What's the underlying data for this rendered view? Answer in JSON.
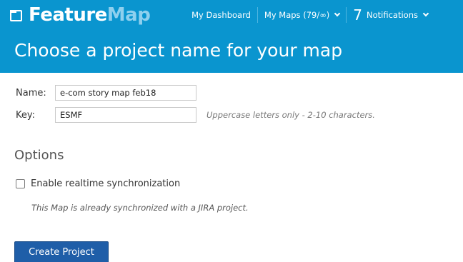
{
  "header": {
    "logo_part1": "Feature",
    "logo_part2": "Map",
    "nav": {
      "dashboard_label": "My Dashboard",
      "maps_label": "My Maps (79/∞)",
      "notifications_count": "7",
      "notifications_label": "Notifications"
    }
  },
  "page": {
    "title": "Choose a project name for your map"
  },
  "form": {
    "name": {
      "label": "Name:",
      "value": "e-com story map feb18"
    },
    "key": {
      "label": "Key:",
      "value": "ESMF",
      "hint": "Uppercase letters only - 2-10 characters."
    }
  },
  "options": {
    "title": "Options",
    "realtime_sync_label": "Enable realtime synchronization",
    "realtime_sync_checked": false,
    "sync_note": "This Map is already synchronized with a JIRA project."
  },
  "actions": {
    "create_label": "Create Project"
  },
  "colors": {
    "brand_blue": "#0a95cf",
    "button_blue": "#1f5ea8"
  }
}
